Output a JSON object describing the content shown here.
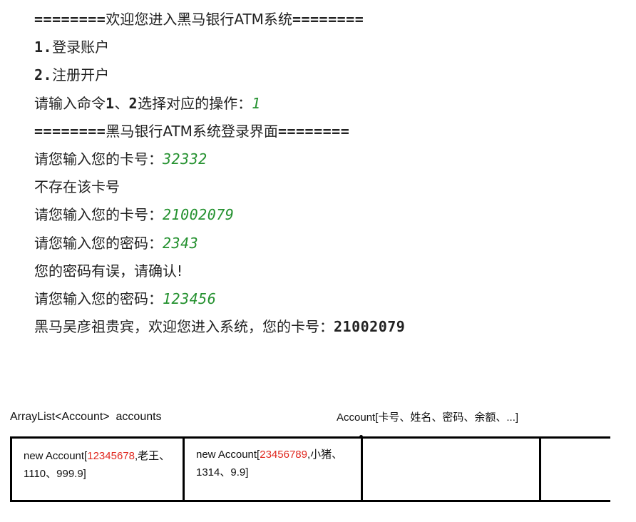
{
  "console": {
    "lines": [
      {
        "prefix": "========",
        "text": "欢迎您进入黑马银行ATM系统",
        "suffix": "========"
      },
      {
        "num": "1.",
        "text": "登录账户"
      },
      {
        "num": "2.",
        "text": "注册开户"
      },
      {
        "text_a": "请输入命令",
        "num_a": "1",
        "text_b": "、",
        "num_b": "2",
        "text_c": "选择对应的操作：",
        "input": "1"
      },
      {
        "prefix": "========",
        "text": "黑马银行ATM系统登录界面",
        "suffix": "========"
      },
      {
        "text": "请您输入您的卡号：",
        "input": "32332"
      },
      {
        "text": "不存在该卡号"
      },
      {
        "text": "请您输入您的卡号：",
        "input": "21002079"
      },
      {
        "text": "请您输入您的密码：",
        "input": "2343"
      },
      {
        "text": "您的密码有误，请确认!"
      },
      {
        "text": "请您输入您的密码：",
        "input": "123456"
      },
      {
        "text": "黑马吴彦祖贵宾，欢迎您进入系统，您的卡号：",
        "value": "21002079"
      }
    ]
  },
  "diagram": {
    "left_caption": "ArrayList<Account>  accounts",
    "right_caption": "Account[卡号、姓名、密码、余额、...]",
    "cells": [
      {
        "prefix": "new Account[",
        "number": "12345678",
        "rest": ",老王、1110、999.9]"
      },
      {
        "prefix": "new Account[",
        "number": "23456789",
        "rest": ",小猪、1314、9.9]"
      },
      {
        "prefix": "",
        "number": "",
        "rest": ""
      },
      {
        "prefix": "",
        "number": "",
        "rest": ""
      }
    ],
    "colors": {
      "highlight": "#e0281f",
      "input": "#24912f",
      "border": "#000000"
    }
  }
}
